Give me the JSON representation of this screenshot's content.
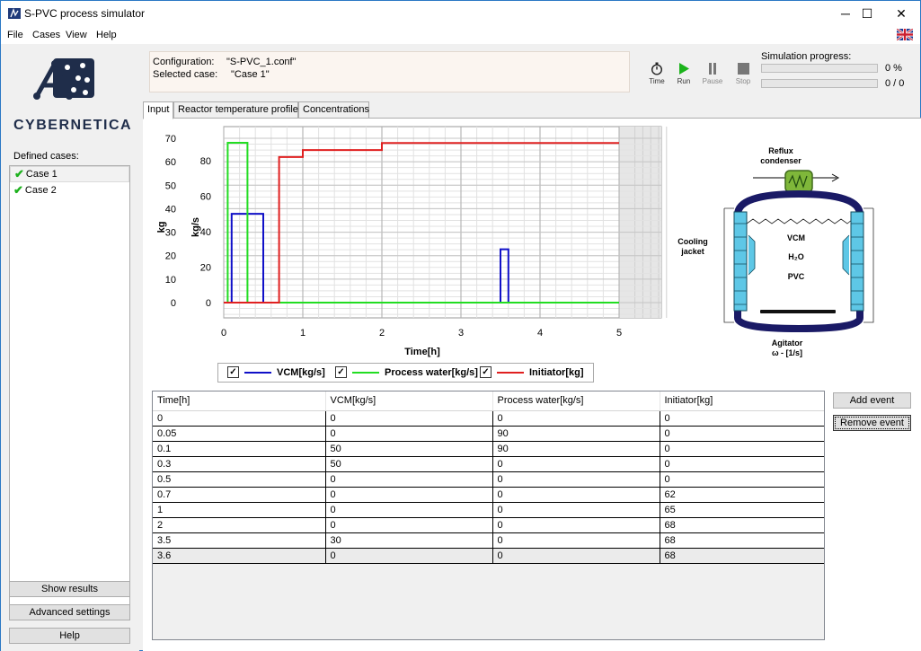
{
  "window": {
    "title": "S-PVC process simulator",
    "minimize": "─",
    "maximize": "☐",
    "close": "✕"
  },
  "menu": [
    {
      "label": "File"
    },
    {
      "label": "Cases"
    },
    {
      "label": "View"
    },
    {
      "label": "Help"
    }
  ],
  "sidebar": {
    "brand": "CYBERNETICA",
    "defined_label": "Defined cases:",
    "cases": [
      {
        "label": "Case 1",
        "ok": true
      },
      {
        "label": "Case 2",
        "ok": true
      }
    ],
    "buttons": {
      "show_results": "Show results",
      "advanced_settings": "Advanced settings",
      "help": "Help"
    }
  },
  "info": {
    "configuration_label": "Configuration:",
    "configuration_value": "\"S-PVC_1.conf\"",
    "selected_label": "Selected case:",
    "selected_value": "\"Case 1\""
  },
  "toolbar": {
    "time": "Time",
    "run": "Run",
    "pause": "Pause",
    "stop": "Stop"
  },
  "progress": {
    "title": "Simulation progress:",
    "percent_text": "0 %",
    "count_text": "0 / 0",
    "percent_fill": 0,
    "count_fill": 0
  },
  "tabs": [
    {
      "label": "Input",
      "active": true
    },
    {
      "label": "Reactor temperature profile",
      "active": false
    },
    {
      "label": "Concentrations",
      "active": false
    }
  ],
  "colors": {
    "vcm": "#1010c8",
    "water": "#22dd22",
    "initiator": "#e02020",
    "accent": "#2b78c5"
  },
  "chart_data": {
    "type": "line",
    "xlabel": "Time[h]",
    "ylabel_left": "kg",
    "ylabel_right": "kg/s",
    "xlim": [
      0,
      5
    ],
    "ylim_left": [
      0,
      70
    ],
    "ylim_right": [
      0,
      90
    ],
    "x_ticks": [
      "0",
      "1",
      "2",
      "3",
      "4",
      "5"
    ],
    "y_ticks_left": [
      "70",
      "60",
      "50",
      "40",
      "30",
      "20",
      "10",
      "0"
    ],
    "y_ticks_right": [
      "80",
      "60",
      "40",
      "20",
      "0"
    ],
    "series": [
      {
        "name": "VCM[kg/s]",
        "axis": "right",
        "color_key": "vcm",
        "x": [
          0,
          0.05,
          0.1,
          0.3,
          0.5,
          0.7,
          1,
          2,
          3.5,
          3.6,
          5
        ],
        "y": [
          0,
          0,
          50,
          50,
          0,
          0,
          0,
          0,
          30,
          0,
          0
        ]
      },
      {
        "name": "Process water[kg/s]",
        "axis": "right",
        "color_key": "water",
        "x": [
          0,
          0.05,
          0.1,
          0.3,
          0.5,
          0.7,
          1,
          2,
          3.5,
          3.6,
          5
        ],
        "y": [
          0,
          90,
          90,
          0,
          0,
          0,
          0,
          0,
          0,
          0,
          0
        ]
      },
      {
        "name": "Initiator[kg]",
        "axis": "left",
        "color_key": "initiator",
        "x": [
          0,
          0.05,
          0.1,
          0.3,
          0.5,
          0.7,
          1,
          2,
          3.5,
          3.6,
          5
        ],
        "y": [
          0,
          0,
          0,
          0,
          0,
          62,
          65,
          68,
          68,
          68,
          68
        ]
      }
    ]
  },
  "legend": [
    {
      "label": "VCM[kg/s]",
      "checked": true,
      "color_key": "vcm"
    },
    {
      "label": "Process water[kg/s]",
      "checked": true,
      "color_key": "water"
    },
    {
      "label": "Initiator[kg]",
      "checked": true,
      "color_key": "initiator"
    }
  ],
  "reactor": {
    "reflux": "Reflux",
    "condenser": "condenser",
    "cooling": "Cooling",
    "jacket": "jacket",
    "vcm": "VCM",
    "h2o": "H₂O",
    "pvc": "PVC",
    "agitator": "Agitator",
    "omega": "ω - [1/s]"
  },
  "table": {
    "headers": [
      "Time[h]",
      "VCM[kg/s]",
      "Process water[kg/s]",
      "Initiator[kg]"
    ],
    "rows": [
      [
        "0",
        "0",
        "0",
        "0"
      ],
      [
        "0.05",
        "0",
        "90",
        "0"
      ],
      [
        "0.1",
        "50",
        "90",
        "0"
      ],
      [
        "0.3",
        "50",
        "0",
        "0"
      ],
      [
        "0.5",
        "0",
        "0",
        "0"
      ],
      [
        "0.7",
        "0",
        "0",
        "62"
      ],
      [
        "1",
        "0",
        "0",
        "65"
      ],
      [
        "2",
        "0",
        "0",
        "68"
      ],
      [
        "3.5",
        "30",
        "0",
        "68"
      ],
      [
        "3.6",
        "0",
        "0",
        "68"
      ]
    ]
  },
  "grid_buttons": {
    "add": "Add event",
    "remove": "Remove event"
  }
}
